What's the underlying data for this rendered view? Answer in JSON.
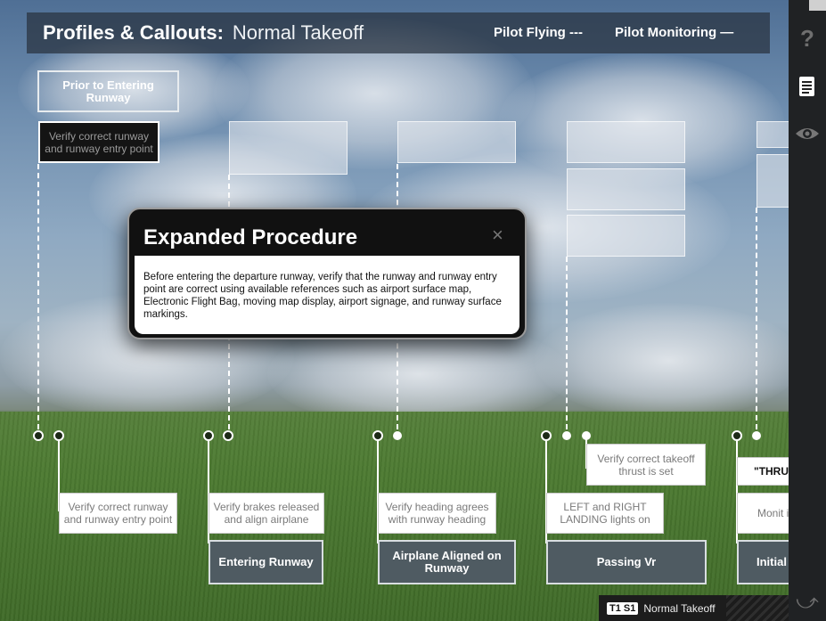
{
  "header": {
    "title_bold": "Profiles & Callouts:",
    "title_sub": "Normal Takeoff",
    "legend_pf": "Pilot Flying ---",
    "legend_pm": "Pilot Monitoring —"
  },
  "toolbar": {
    "help_icon": "question-mark-icon",
    "notes_icon": "document-icon",
    "view_icon": "eye-icon",
    "back_icon": "return-arrow-icon"
  },
  "columns": {
    "prior_header": "Prior to Entering Runway",
    "pf_top_1": "Verify correct runway and runway entry point",
    "pm_notes": [
      "Verify correct runway and runway entry point",
      "Verify brakes released and align airplane",
      "Verify heading agrees with runway heading",
      "LEFT and RIGHT LANDING lights on",
      "Verify correct takeoff thrust is set",
      "Monit instr"
    ],
    "callout_thrust": "\"THRU",
    "phases": [
      "Entering Runway",
      "Airplane Aligned on Runway",
      "Passing Vr",
      "Initial"
    ]
  },
  "modal": {
    "title": "Expanded Procedure",
    "close_label": "×",
    "body": "Before entering the departure runway, verify that the runway and runway entry point are correct using available references such as airport surface map, Electronic Flight Bag, moving map display, airport signage, and runway surface markings."
  },
  "footer": {
    "tag": "T1 S1",
    "label": "Normal Takeoff"
  }
}
